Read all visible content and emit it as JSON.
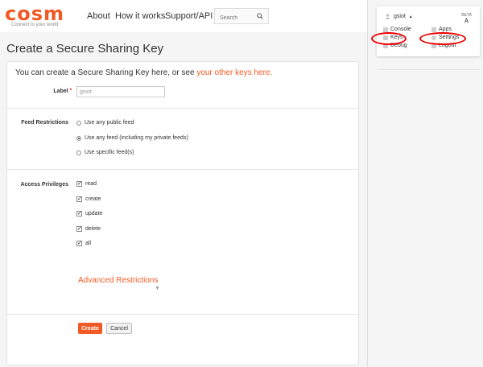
{
  "brand": {
    "name": "cosm",
    "tagline": "Connect to your world"
  },
  "nav": {
    "about": "About",
    "how": "How it works",
    "support": "Support/API"
  },
  "search": {
    "placeholder": "Search"
  },
  "page": {
    "title": "Create a Secure Sharing Key"
  },
  "intro": {
    "text": "You can create a Secure Sharing Key here, or see ",
    "link": "your other keys here."
  },
  "form": {
    "label_label": "Label",
    "required_mark": "*",
    "label_value": "gsiot",
    "feed_restrictions_label": "Feed Restrictions",
    "feed_options": [
      {
        "label": "Use any public feed",
        "selected": false
      },
      {
        "label": "Use any feed (including my private feeds)",
        "selected": true
      },
      {
        "label": "Use specific feed(s)",
        "selected": false
      }
    ],
    "access_label": "Access Privileges",
    "privileges": [
      {
        "label": "read",
        "checked": true
      },
      {
        "label": "create",
        "checked": true
      },
      {
        "label": "update",
        "checked": true
      },
      {
        "label": "delete",
        "checked": true
      },
      {
        "label": "all",
        "checked": true
      }
    ],
    "advanced": "Advanced Restrictions",
    "create_button": "Create",
    "cancel_button": "Cancel"
  },
  "user_menu": {
    "username": "gsiot",
    "caret": "▲",
    "beta": "BETA",
    "items": [
      "Console",
      "Apps",
      "Keys",
      "Settings",
      "Debug",
      "Logout"
    ]
  },
  "colors": {
    "accent": "#f15a24",
    "annotation": "#e00000"
  }
}
